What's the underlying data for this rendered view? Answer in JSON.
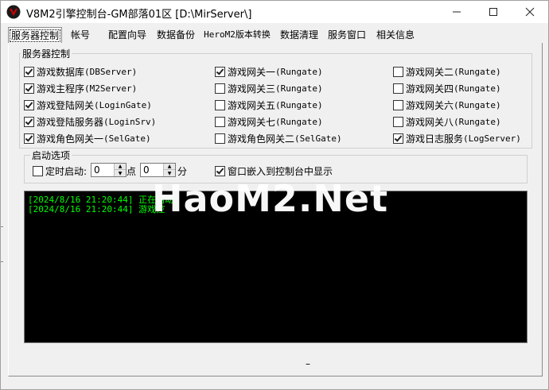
{
  "window": {
    "title": "V8M2引擎控制台-GM部落01区 [D:\\MirServer\\]",
    "min_icon": "minimize-icon",
    "max_icon": "maximize-icon",
    "close_icon": "close-icon"
  },
  "tabs": [
    "服务器控制",
    "帐号",
    "配置向导",
    "数据备份",
    "HeroM2版本转换",
    "数据清理",
    "服务窗口",
    "相关信息"
  ],
  "server_control": {
    "label": "服务器控制",
    "items": [
      {
        "name": "游戏数据库",
        "code": "(DBServer)",
        "checked": true
      },
      {
        "name": "游戏网关一",
        "code": "(Rungate)",
        "checked": true
      },
      {
        "name": "游戏网关二",
        "code": "(Rungate)",
        "checked": false
      },
      {
        "name": "游戏主程序",
        "code": "(M2Server)",
        "checked": true
      },
      {
        "name": "游戏网关三",
        "code": "(Rungate)",
        "checked": false
      },
      {
        "name": "游戏网关四",
        "code": "(Rungate)",
        "checked": false
      },
      {
        "name": "游戏登陆网关",
        "code": "(LoginGate)",
        "checked": true
      },
      {
        "name": "游戏网关五",
        "code": "(Rungate)",
        "checked": false
      },
      {
        "name": "游戏网关六",
        "code": "(Rungate)",
        "checked": false
      },
      {
        "name": "游戏登陆服务器",
        "code": "(LoginSrv)",
        "checked": true
      },
      {
        "name": "游戏网关七",
        "code": "(Rungate)",
        "checked": false
      },
      {
        "name": "游戏网关八",
        "code": "(Rungate)",
        "checked": false
      },
      {
        "name": "游戏角色网关一",
        "code": "(SelGate)",
        "checked": true
      },
      {
        "name": "游戏角色网关二",
        "code": "(SelGate)",
        "checked": false
      },
      {
        "name": "游戏日志服务",
        "code": "(LogServer)",
        "checked": true
      }
    ]
  },
  "startup": {
    "label": "启动选项",
    "timed_start_label": "定时启动:",
    "timed_start_checked": false,
    "hour_value": "0",
    "hour_unit": "点",
    "minute_value": "0",
    "minute_unit": "分",
    "embed_label": "窗口嵌入到控制台中显示",
    "embed_checked": true
  },
  "console": {
    "lines": [
      "[2024/8/16 21:20:44] 正在启动",
      "[2024/8/16 21:20:44] 游戏控"
    ],
    "text_color": "#00ff00"
  },
  "watermark": "HaoM2.Net",
  "footer_dash": "–"
}
